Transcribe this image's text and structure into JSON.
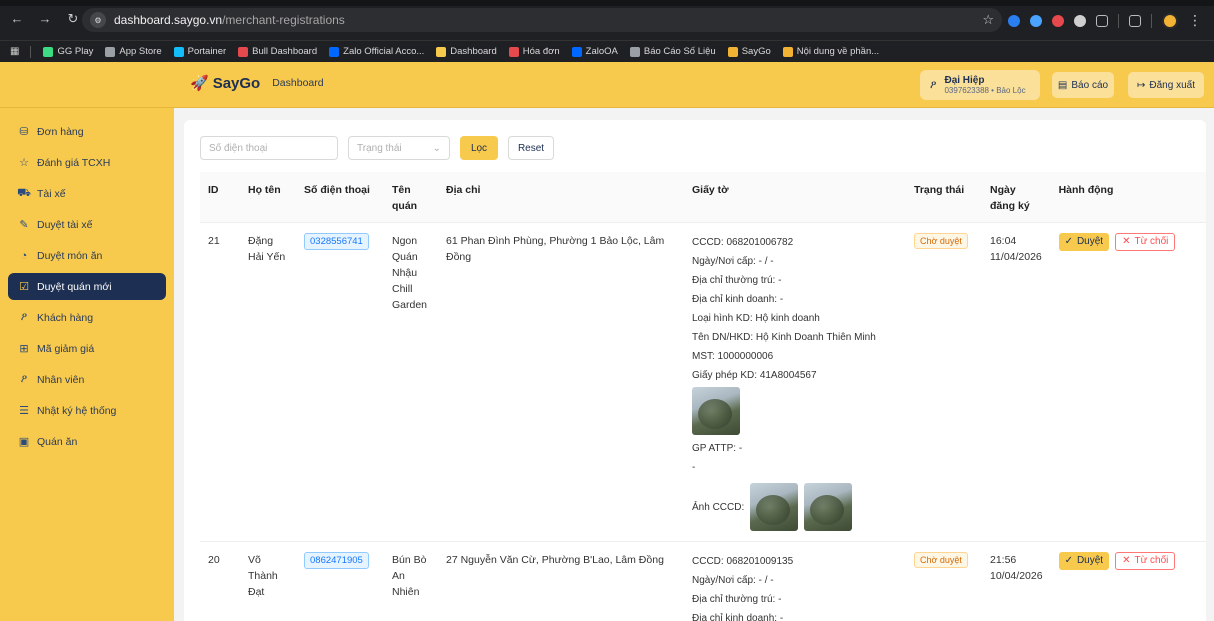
{
  "browser": {
    "url_domain": "dashboard.saygo.vn",
    "url_path": "/merchant-registrations",
    "bookmarks": [
      {
        "label": "GG Play",
        "color": "#3ddc84"
      },
      {
        "label": "App Store",
        "color": "#9aa0a6"
      },
      {
        "label": "Portainer",
        "color": "#13bef9"
      },
      {
        "label": "Bull Dashboard",
        "color": "#e5484d"
      },
      {
        "label": "Zalo Official Acco...",
        "color": "#0068ff"
      },
      {
        "label": "Dashboard",
        "color": "#f7c94d"
      },
      {
        "label": "Hóa đơn",
        "color": "#e5484d"
      },
      {
        "label": "ZaloOA",
        "color": "#0068ff"
      },
      {
        "label": "Báo Cáo Số Liệu",
        "color": "#9aa0a6"
      },
      {
        "label": "SayGo",
        "color": "#f2b233"
      },
      {
        "label": "Nội dung về phần...",
        "color": "#f2b233"
      }
    ]
  },
  "app": {
    "brand": "SayGo",
    "section": "Dashboard",
    "user_name": "Đại Hiệp",
    "user_meta": "0397623388 • Bảo Lộc",
    "report_label": "Báo cáo",
    "logout_label": "Đăng xuất"
  },
  "sidebar": {
    "items": [
      {
        "label": "Đơn hàng",
        "icon": "bag-icon"
      },
      {
        "label": "Đánh giá TCXH",
        "icon": "star-icon"
      },
      {
        "label": "Tài xế",
        "icon": "car-icon"
      },
      {
        "label": "Duyệt tài xế",
        "icon": "edit-icon"
      },
      {
        "label": "Duyệt món ăn",
        "icon": "dish-icon"
      },
      {
        "label": "Duyệt quán mới",
        "icon": "check-square-icon"
      },
      {
        "label": "Khách hàng",
        "icon": "user-icon"
      },
      {
        "label": "Mã giảm giá",
        "icon": "gift-icon"
      },
      {
        "label": "Nhân viên",
        "icon": "user-icon"
      },
      {
        "label": "Nhật ký hệ thống",
        "icon": "log-icon"
      },
      {
        "label": "Quán ăn",
        "icon": "store-icon"
      }
    ],
    "active_index": 5
  },
  "filters": {
    "phone_placeholder": "Số điện thoại",
    "status_placeholder": "Trạng thái",
    "filter_label": "Lọc",
    "reset_label": "Reset"
  },
  "table": {
    "headers": [
      "ID",
      "Họ tên",
      "Số điện thoại",
      "Tên quán",
      "Địa chỉ",
      "Giấy tờ",
      "Trạng thái",
      "Ngày đăng ký",
      "Hành động"
    ],
    "approve_label": "Duyệt",
    "reject_label": "Từ chối",
    "rows": [
      {
        "id": "21",
        "name": "Đặng Hải Yến",
        "phone": "0328556741",
        "shop": "Ngon Quán Nhậu Chill Garden",
        "address": "61 Phan Đình Phùng, Phường 1 Bảo Lộc, Lâm Đồng",
        "docs": {
          "cccd": "CCCD: 068201006782",
          "issue": "Ngày/Nơi cấp: - / -",
          "permanent": "Địa chỉ thường trú: -",
          "business_addr": "Địa chỉ kinh doanh: -",
          "type": "Loại hình KD: Hộ kinh doanh",
          "company": "Tên DN/HKD: Hộ Kinh Doanh Thiên Minh",
          "tax": "MST: 1000000006",
          "license": "Giấy phép KD: 41A8004567",
          "food_permit": "GP ATTP: -",
          "dash": "-",
          "cccd_images": "Ảnh CCCD:"
        },
        "status": "Chờ duyệt",
        "date_time": "16:04",
        "date": "11/04/2026"
      },
      {
        "id": "20",
        "name": "Võ Thành Đạt",
        "phone": "0862471905",
        "shop": "Bún Bò An Nhiên",
        "address": "27 Nguyễn Văn Cừ, Phường B'Lao, Lâm Đồng",
        "docs": {
          "cccd": "CCCD: 068201009135",
          "issue": "Ngày/Nơi cấp: - / -",
          "permanent": "Địa chỉ thường trú: -",
          "business_addr": "Địa chỉ kinh doanh: -"
        },
        "status": "Chờ duyệt",
        "date_time": "21:56",
        "date": "10/04/2026"
      }
    ]
  }
}
